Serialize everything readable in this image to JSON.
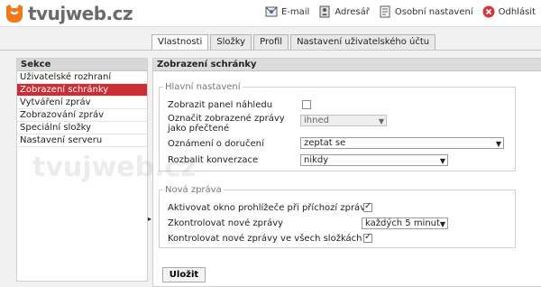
{
  "brand": {
    "name": "tvujweb.cz",
    "accent": "#c82e33",
    "logo_color": "#f07a1a"
  },
  "toplinks": [
    {
      "label": "E-mail",
      "icon": "mail-icon"
    },
    {
      "label": "Adresář",
      "icon": "address-book-icon"
    },
    {
      "label": "Osobní nastavení",
      "icon": "settings-doc-icon"
    },
    {
      "label": "Odhlásit",
      "icon": "close-icon"
    }
  ],
  "tabs": [
    {
      "label": "Vlastnosti",
      "active": true
    },
    {
      "label": "Složky",
      "active": false
    },
    {
      "label": "Profil",
      "active": false
    },
    {
      "label": "Nastavení uživatelského účtu",
      "active": false
    }
  ],
  "sidebar": {
    "title": "Sekce",
    "items": [
      {
        "label": "Uživatelské rozhraní",
        "active": false
      },
      {
        "label": "Zobrazení schránky",
        "active": true
      },
      {
        "label": "Vytváření zpráv",
        "active": false
      },
      {
        "label": "Zobrazování zpráv",
        "active": false
      },
      {
        "label": "Speciální složky",
        "active": false
      },
      {
        "label": "Nastavení serveru",
        "active": false
      }
    ]
  },
  "main": {
    "title": "Zobrazení schránky",
    "main_settings": {
      "legend": "Hlavní nastavení",
      "show_preview_label": "Zobrazit panel náhledu",
      "show_preview_checked": false,
      "mark_read_label_1": "Označit zobrazené zprávy",
      "mark_read_label_2": "jako přečtené",
      "mark_read_value": "ihned",
      "receipt_label": "Oznámení o doručení",
      "receipt_value": "zeptat se",
      "expand_label": "Rozbalit konverzace",
      "expand_value": "nikdy"
    },
    "new_message": {
      "legend": "Nová zpráva",
      "activate_label": "Aktivovat okno prohlížeče při příchozí zprávě",
      "activate_checked": true,
      "check_label": "Zkontrolovat nové zprávy",
      "check_value": "každých 5 minut",
      "check_all_label": "Kontrolovat nové zprávy ve všech složkách",
      "check_all_checked": true
    },
    "save_label": "Uložit"
  },
  "watermark": "tvujweb.cz"
}
